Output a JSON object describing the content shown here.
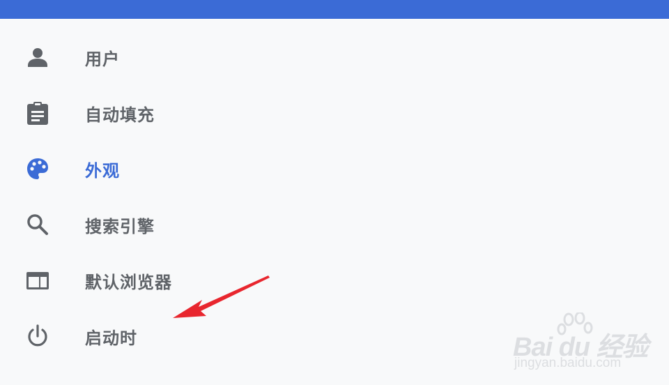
{
  "header": {
    "accent_color": "#3b6bd6"
  },
  "menu": {
    "items": [
      {
        "label": "用户",
        "icon": "person-icon",
        "active": false
      },
      {
        "label": "自动填充",
        "icon": "clipboard-icon",
        "active": false
      },
      {
        "label": "外观",
        "icon": "palette-icon",
        "active": true
      },
      {
        "label": "搜索引擎",
        "icon": "search-icon",
        "active": false
      },
      {
        "label": "默认浏览器",
        "icon": "browser-window-icon",
        "active": false
      },
      {
        "label": "启动时",
        "icon": "power-icon",
        "active": false
      }
    ]
  },
  "annotation": {
    "arrow_color": "#e8262e",
    "arrow_icon": "red-arrow-annotation"
  },
  "watermark": {
    "brand": "Bai du 经验",
    "url": "jingyan.baidu.com"
  }
}
